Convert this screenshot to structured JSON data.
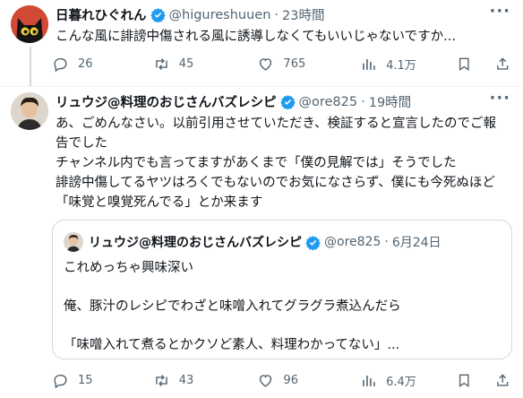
{
  "tweet1": {
    "name": "日暮れひぐれん",
    "handle": "@higureshuuen",
    "time": "23時間",
    "text": "こんな風に誹謗中傷される風に誘導しなくてもいいじゃないですか...",
    "replies": "26",
    "retweets": "45",
    "likes": "765",
    "views": "4.1万"
  },
  "tweet2": {
    "name": "リュウジ@料理のおじさんバズレシピ",
    "handle": "@ore825",
    "time": "19時間",
    "text": "あ、ごめんなさい。以前引用させていただき、検証すると宣言したのでご報\n告でした\nチャンネル内でも言ってますがあくまで「僕の見解では」そうでした\n誹謗中傷してるヤツはろくでもないのでお気になさらず、僕にも今死ぬほど\n「味覚と嗅覚死んでる」とか来ます",
    "quote": {
      "name": "リュウジ@料理のおじさんバズレシピ",
      "handle": "@ore825",
      "date": "6月24日",
      "text": "これめっちゃ興味深い\n\n俺、豚汁のレシピでわざと味噌入れてグラグラ煮込んだら\n\n「味噌入れて煮るとかクソど素人、料理わかってない」..."
    },
    "replies": "15",
    "retweets": "43",
    "likes": "96",
    "views": "6.4万"
  },
  "colors": {
    "verified": "#1d9bf0",
    "muted": "#536471",
    "border": "#cfd9de"
  }
}
